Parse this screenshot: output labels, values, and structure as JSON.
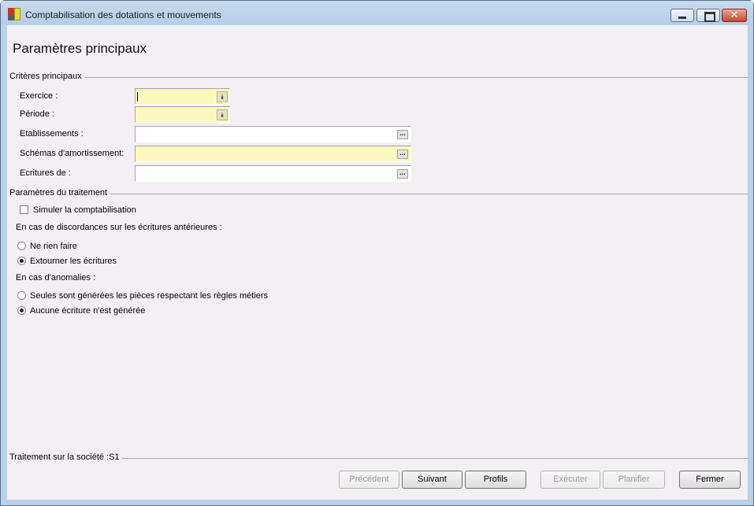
{
  "window": {
    "title": "Comptabilisation des dotations et mouvements",
    "controls": {
      "minimize": "minimize",
      "maximize": "maximize",
      "close": "✕"
    }
  },
  "page_title": "Paramètres principaux",
  "criteria": {
    "header": "Critères principaux",
    "fields": [
      {
        "label": "Exercice :",
        "value": "",
        "type": "combo",
        "required": true
      },
      {
        "label": "Période :",
        "value": "",
        "type": "combo",
        "required": true
      },
      {
        "label": "Etablissements :",
        "value": "",
        "type": "lookup",
        "required": false
      },
      {
        "label": "Schémas d'amortissement:",
        "value": "",
        "type": "lookup",
        "required": true
      },
      {
        "label": "Ecritures de :",
        "value": "",
        "type": "lookup",
        "required": false
      }
    ],
    "lookup_symbol": "...",
    "combo_symbol": "⯯"
  },
  "processing": {
    "header": "Paramètres du traitement",
    "simulate_label": "Simuler la comptabilisation",
    "simulate_checked": false,
    "discrepancy_label": "En cas de discordances sur les écritures antérieures :",
    "discrepancy_options": [
      {
        "label": "Ne rien faire",
        "selected": false
      },
      {
        "label": "Extourner les écritures",
        "selected": true
      }
    ],
    "anomaly_label": "En cas d'anomalies :",
    "anomaly_options": [
      {
        "label": "Seules sont générées les pièces respectant les règles métiers",
        "selected": false
      },
      {
        "label": "Aucune écriture n'est générée",
        "selected": true
      }
    ]
  },
  "footer": {
    "company_label": "Traitement sur la société :S1"
  },
  "buttons": {
    "previous": "Précédent",
    "next": "Suivant",
    "profiles": "Profils",
    "execute": "Exécuter",
    "schedule": "Planifier",
    "close": "Fermer"
  },
  "colors": {
    "required_field": "#fcf7bd",
    "client_background": "#f4eff4",
    "title_bar": "#b9d1ea"
  }
}
